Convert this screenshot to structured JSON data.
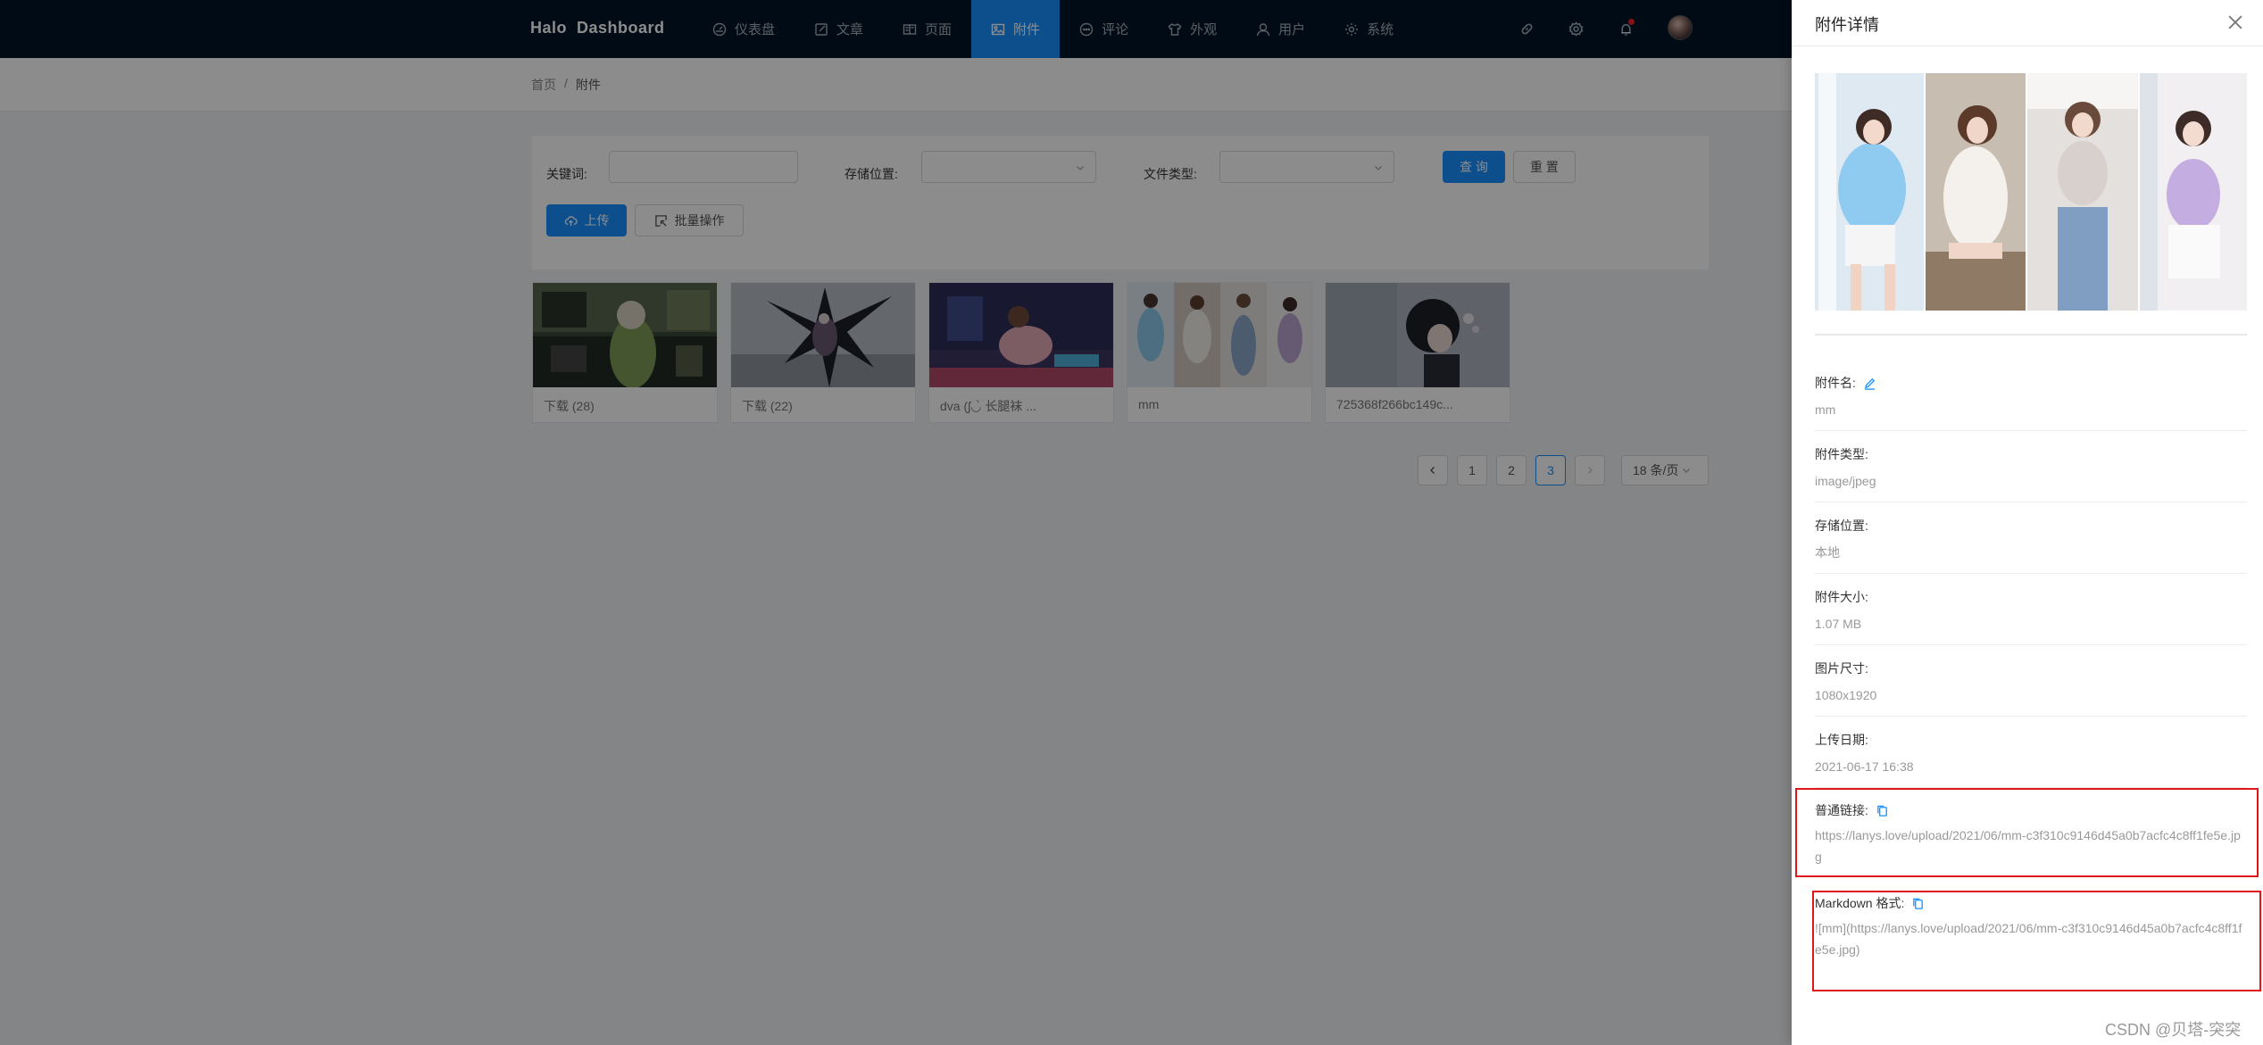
{
  "app": {
    "brand": "Halo  Dashboard"
  },
  "nav": [
    {
      "label": "仪表盘",
      "icon": "dashboard-icon"
    },
    {
      "label": "文章",
      "icon": "edit-icon"
    },
    {
      "label": "页面",
      "icon": "read-icon"
    },
    {
      "label": "附件",
      "icon": "picture-icon",
      "active": true
    },
    {
      "label": "评论",
      "icon": "message-icon"
    },
    {
      "label": "外观",
      "icon": "skin-icon"
    },
    {
      "label": "用户",
      "icon": "user-icon"
    },
    {
      "label": "系统",
      "icon": "setting-icon"
    }
  ],
  "breadcrumb": {
    "home": "首页",
    "separator": "/",
    "current": "附件"
  },
  "filters": {
    "keyword_label": "关键词:",
    "keyword_value": "",
    "storage_label": "存储位置:",
    "storage_value": "",
    "filetype_label": "文件类型:",
    "filetype_value": "",
    "query_label": "查 询",
    "reset_label": "重 置"
  },
  "actions": {
    "upload_label": "上传",
    "batch_label": "批量操作"
  },
  "attachments": [
    {
      "name": "下载 (28)"
    },
    {
      "name": "下载 (22)"
    },
    {
      "name": "dva (ʃ◡̀ 长腿袜 ..."
    },
    {
      "name": "mm"
    },
    {
      "name": "725368f266bc149c..."
    }
  ],
  "pagination": {
    "pages": [
      "1",
      "2",
      "3"
    ],
    "current": "3",
    "page_size": "18 条/页"
  },
  "drawer": {
    "title": "附件详情",
    "name_label": "附件名:",
    "name_value": "mm",
    "type_label": "附件类型:",
    "type_value": "image/jpeg",
    "storage_label": "存储位置:",
    "storage_value": "本地",
    "size_label": "附件大小:",
    "size_value": "1.07 MB",
    "dimension_label": "图片尺寸:",
    "dimension_value": "1080x1920",
    "date_label": "上传日期:",
    "date_value": "2021-06-17 16:38",
    "link_label": "普通链接:",
    "link_value": "https://lanys.love/upload/2021/06/mm-c3f310c9146d45a0b7acfc4c8ff1fe5e.jpg",
    "markdown_label": "Markdown 格式:",
    "markdown_value": "![mm](https://lanys.love/upload/2021/06/mm-c3f310c9146d45a0b7acfc4c8ff1fe5e.jpg)"
  },
  "watermark": "CSDN @贝塔-突突",
  "colors": {
    "nav_bg": "#001529",
    "primary": "#1890ff",
    "highlight": "#e0161b"
  }
}
